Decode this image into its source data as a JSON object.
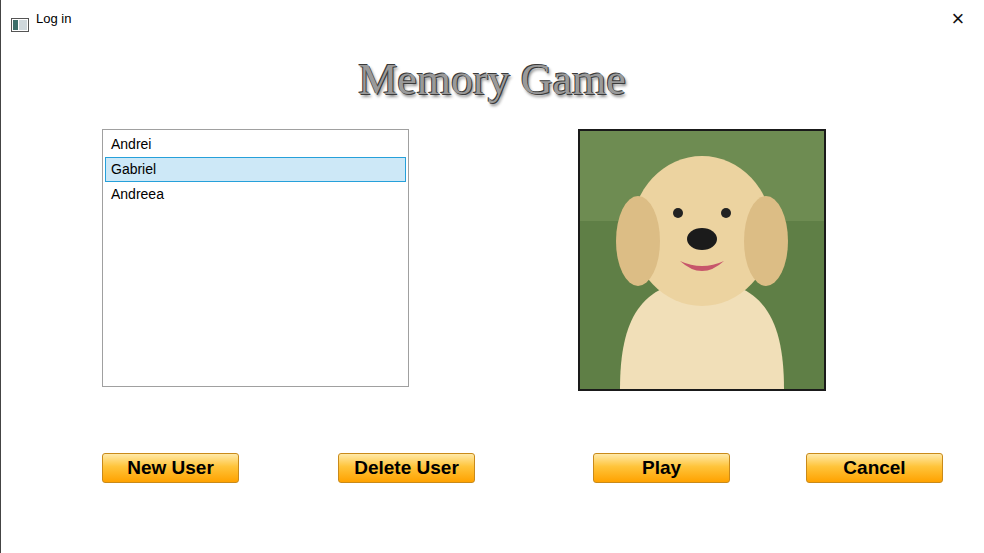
{
  "window": {
    "title": "Log in",
    "close": "×"
  },
  "heading": "Memory Game",
  "users": [
    {
      "name": "Andrei",
      "selected": false
    },
    {
      "name": "Gabriel",
      "selected": true
    },
    {
      "name": "Andreea",
      "selected": false
    }
  ],
  "buttons": [
    "New User",
    "Delete User",
    "Play",
    "Cancel"
  ]
}
